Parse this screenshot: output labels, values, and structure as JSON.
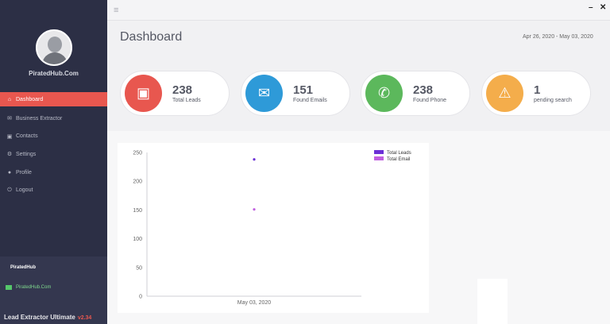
{
  "sidebar": {
    "brand": "PiratedHub.Com",
    "items": [
      {
        "label": "Dashboard",
        "icon": "home-icon",
        "active": true
      },
      {
        "label": "Business Extractor",
        "icon": "envelope-icon"
      },
      {
        "label": "Contacts",
        "icon": "address-book-icon"
      },
      {
        "label": "Settings",
        "icon": "gears-icon"
      },
      {
        "label": "Profile",
        "icon": "user-icon"
      },
      {
        "label": "Logout",
        "icon": "power-icon"
      }
    ],
    "footer": {
      "title": "PiratedHub",
      "site": "PiratedHub.Com",
      "product": "Lead Extractor Ultimate",
      "version": "v2.34"
    }
  },
  "header": {
    "title": "Dashboard",
    "date_range": "Apr 26, 2020 - May 03, 2020"
  },
  "stats": [
    {
      "value": "238",
      "label": "Total Leads",
      "color": "#e8574f",
      "icon": "address-book-icon"
    },
    {
      "value": "151",
      "label": "Found Emails",
      "color": "#2e9ad8",
      "icon": "envelope-icon"
    },
    {
      "value": "238",
      "label": "Found Phone",
      "color": "#5cb85c",
      "icon": "phone-icon"
    },
    {
      "value": "1",
      "label": "pending search",
      "color": "#f4ad4b",
      "icon": "warning-icon"
    }
  ],
  "chart_data": {
    "type": "scatter",
    "categories": [
      "May 03, 2020"
    ],
    "series": [
      {
        "name": "Total Leads",
        "values": [
          238
        ],
        "color": "#6b2fd6"
      },
      {
        "name": "Total Email",
        "values": [
          151
        ],
        "color": "#c05fe0"
      }
    ],
    "yticks": [
      "0",
      "50",
      "100",
      "150",
      "200",
      "250"
    ],
    "ylim": [
      0,
      250
    ],
    "legend": "top-right",
    "grid": false
  }
}
